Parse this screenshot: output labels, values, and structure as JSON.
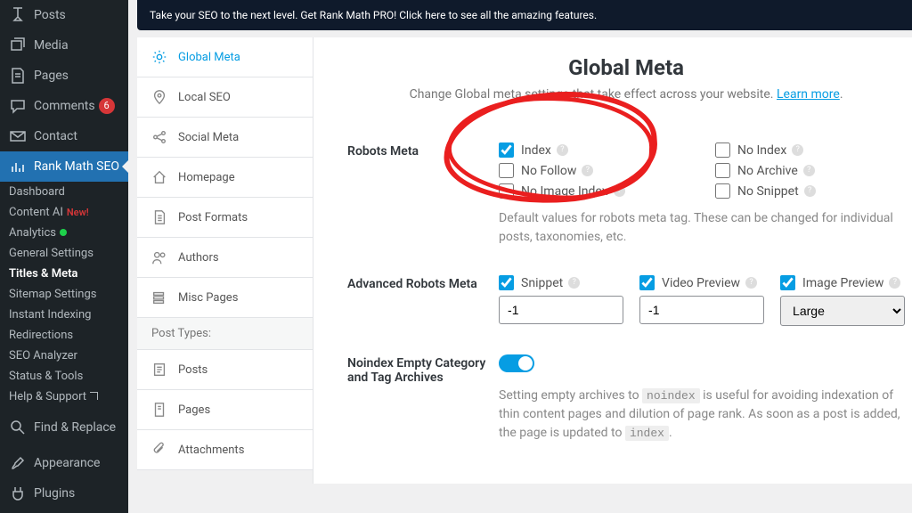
{
  "wp_sidebar": {
    "items": [
      {
        "label": "Posts",
        "icon": "pin"
      },
      {
        "label": "Media",
        "icon": "media"
      },
      {
        "label": "Pages",
        "icon": "page"
      },
      {
        "label": "Comments",
        "icon": "comment",
        "badge": "6"
      },
      {
        "label": "Contact",
        "icon": "envelope"
      },
      {
        "label": "Rank Math SEO",
        "icon": "chart",
        "selected": true
      },
      {
        "label": "Find & Replace",
        "icon": "magnify"
      },
      {
        "label": "Appearance",
        "icon": "brush"
      },
      {
        "label": "Plugins",
        "icon": "plug"
      }
    ],
    "submenu": [
      {
        "label": "Dashboard"
      },
      {
        "label": "Content AI",
        "tag": "New!"
      },
      {
        "label": "Analytics",
        "dot": true
      },
      {
        "label": "General Settings"
      },
      {
        "label": "Titles & Meta",
        "active": true
      },
      {
        "label": "Sitemap Settings"
      },
      {
        "label": "Instant Indexing"
      },
      {
        "label": "Redirections"
      },
      {
        "label": "SEO Analyzer"
      },
      {
        "label": "Status & Tools"
      },
      {
        "label": "Help & Support",
        "ext": true
      }
    ]
  },
  "notice": {
    "text": "Take your SEO to the next level. Get Rank Math PRO! Click here to see all the amazing features."
  },
  "rm_tabs": [
    {
      "label": "Global Meta",
      "active": true
    },
    {
      "label": "Local SEO"
    },
    {
      "label": "Social Meta"
    },
    {
      "label": "Homepage"
    },
    {
      "label": "Post Formats"
    },
    {
      "label": "Authors"
    },
    {
      "label": "Misc Pages"
    }
  ],
  "rm_group_header": "Post Types:",
  "rm_tabs_post_types": [
    {
      "label": "Posts"
    },
    {
      "label": "Pages"
    },
    {
      "label": "Attachments"
    }
  ],
  "panel": {
    "title": "Global Meta",
    "subtitle_prefix": "Change Global meta settings that take effect across your website. ",
    "subtitle_link": "Learn more",
    "robots_label": "Robots Meta",
    "robots": [
      {
        "label": "Index",
        "checked": true
      },
      {
        "label": "No Index",
        "checked": false
      },
      {
        "label": "No Follow",
        "checked": false
      },
      {
        "label": "No Archive",
        "checked": false
      },
      {
        "label": "No Image Index",
        "checked": false
      },
      {
        "label": "No Snippet",
        "checked": false
      }
    ],
    "robots_help": "Default values for robots meta tag. These can be changed for individual posts, taxonomies, etc.",
    "adv_label": "Advanced Robots Meta",
    "adv": [
      {
        "label": "Snippet",
        "value": "-1",
        "kind": "text",
        "checked": true
      },
      {
        "label": "Video Preview",
        "value": "-1",
        "kind": "text",
        "checked": true
      },
      {
        "label": "Image Preview",
        "value": "Large",
        "kind": "select",
        "checked": true
      }
    ],
    "noindex_label": "Noindex Empty Category and Tag Archives",
    "noindex_help_pre": "Setting empty archives to ",
    "noindex_help_code1": "noindex",
    "noindex_help_mid": " is useful for avoiding indexation of thin content pages and dilution of page rank. As soon as a post is added, the page is updated to ",
    "noindex_help_code2": "index",
    "noindex_help_post": "."
  }
}
